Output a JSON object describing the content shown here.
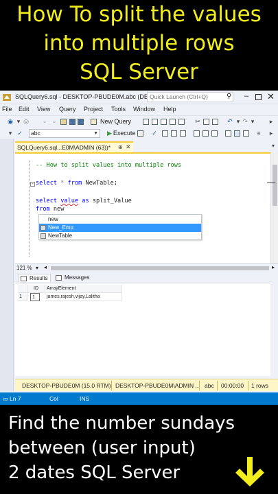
{
  "top_banner": {
    "line1": "How To split the values",
    "line2": "into multiple rows",
    "line3": "SQL Server",
    "color": "#f2ee1e"
  },
  "window": {
    "title": "SQLQuery6.sql - DESKTOP-PBUDE0M.abc (DE...",
    "quick_launch_placeholder": "Quick Launch (Ctrl+Q)",
    "minimize": "–",
    "close": "✕"
  },
  "menu": [
    "File",
    "Edit",
    "View",
    "Query",
    "Project",
    "Tools",
    "Window",
    "Help"
  ],
  "toolbar": {
    "new_query": "New Query",
    "database": "abc",
    "execute": "Execute"
  },
  "document_tab": {
    "label": "SQLQuery6.sql...E0M\\ADMIN (63))*",
    "pin": "⊕",
    "close": "✕"
  },
  "editor": {
    "comment": "-- How to split values into multiple rows",
    "line_select_kw1": "select",
    "line_select_rest1": " * ",
    "line_select_kw2": "from",
    "line_select_rest2": " NewTable;",
    "line3_kw": "select",
    "line3_value": "value",
    "line3_kw2": "as",
    "line3_rest": " split_Value",
    "line4_kw": "from",
    "line4_rest": " new"
  },
  "intellisense": {
    "items": [
      "new",
      "New_Emp",
      "NewTable"
    ],
    "selected_index": 1
  },
  "zoom": "121 %",
  "results": {
    "tabs": [
      "Results",
      "Messages"
    ],
    "columns": [
      "ID",
      "ArrayElement"
    ],
    "rows": [
      {
        "rownum": "1",
        "id": "1",
        "array_element": "james,rajesh,vijay,Lalitha"
      }
    ]
  },
  "status": {
    "server": "DESKTOP-PBUDE0M (15.0 RTM)",
    "user": "DESKTOP-PBUDE0M\\ADMIN ...",
    "database": "abc",
    "time": "00:00:00",
    "rows": "1 rows"
  },
  "bottom_status": {
    "ln": "Ln 7",
    "col": "Col",
    "ins": "INS"
  },
  "bottom_banner": {
    "line1": "Find the number sundays",
    "line2": "between (user input)",
    "line3": "2 dates SQL Server",
    "arrow_color": "#f2ee1e"
  }
}
